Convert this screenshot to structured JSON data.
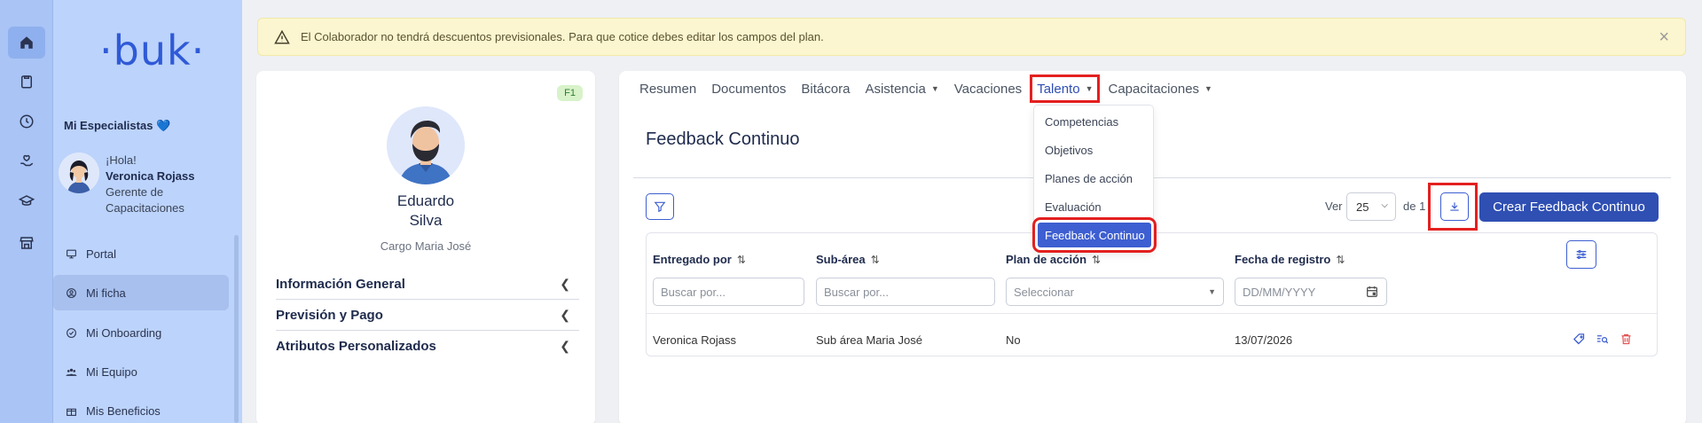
{
  "alert": {
    "text": "El Colaborador no tendrá descuentos previsionales. Para que cotice debes editar los campos del plan.",
    "close": "×"
  },
  "logo": "·buk·",
  "sidebar": {
    "specialists": "Mi Especialistas 💙",
    "greeting": "¡Hola!",
    "user_name": "Veronica Rojass",
    "user_role_1": "Gerente de",
    "user_role_2": "Capacitaciones",
    "items": [
      {
        "label": "Portal",
        "icon": "monitor-icon"
      },
      {
        "label": "Mi ficha",
        "icon": "user-circle-icon"
      },
      {
        "label": "Mi Onboarding",
        "icon": "check-circle-icon"
      },
      {
        "label": "Mi Equipo",
        "icon": "team-icon"
      },
      {
        "label": "Mis Beneficios",
        "icon": "gift-icon"
      }
    ]
  },
  "profile": {
    "badge": "F1",
    "first_name": "Eduardo",
    "last_name": "Silva",
    "cargo": "Cargo Maria José",
    "sections": [
      "Información General",
      "Previsión y Pago",
      "Atributos Personalizados"
    ]
  },
  "tabs": [
    "Resumen",
    "Documentos",
    "Bitácora",
    "Asistencia",
    "Vacaciones",
    "Talento",
    "Capacitaciones"
  ],
  "talento_menu": [
    "Competencias",
    "Objetivos",
    "Planes de acción",
    "Evaluación",
    "Feedback Continuo"
  ],
  "page_title": "Feedback Continuo",
  "pagination": {
    "ver_label": "Ver",
    "per_page": "25",
    "de_label": "de 1"
  },
  "create_button": "Crear Feedback Continuo",
  "table": {
    "headers": [
      "Entregado por",
      "Sub-área",
      "Plan de acción",
      "Fecha de registro"
    ],
    "placeholders": [
      "Buscar por...",
      "Buscar por...",
      "Seleccionar",
      "DD/MM/YYYY"
    ],
    "rows": [
      {
        "entregado": "Veronica Rojass",
        "subarea": "Sub área Maria José",
        "plan": "No",
        "fecha": "13/07/2026"
      }
    ]
  },
  "colors": {
    "primary": "#2f4fb3",
    "highlight": "#e32020",
    "sidebar": "#bcd3fb"
  }
}
